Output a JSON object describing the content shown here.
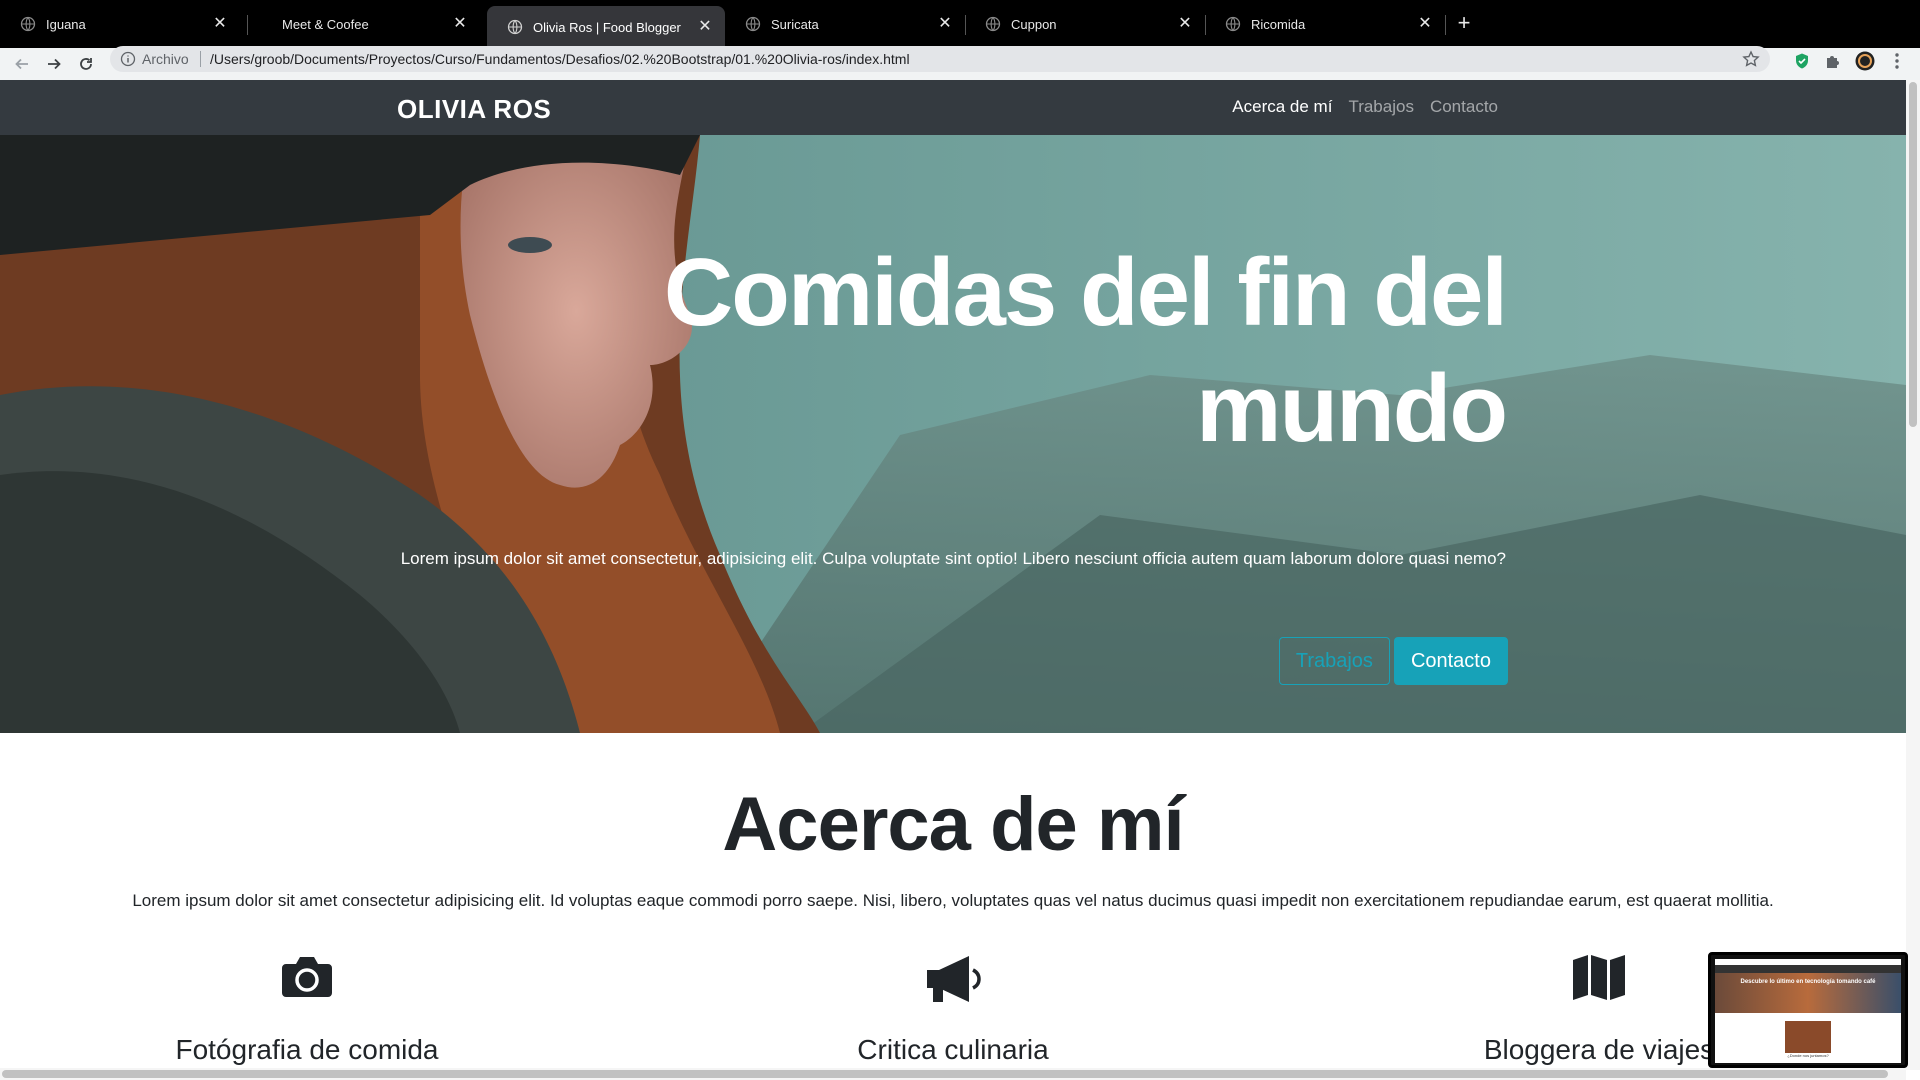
{
  "browser": {
    "tabs": [
      {
        "title": "Iguana",
        "active": false
      },
      {
        "title": "Meet & Coofee",
        "active": false
      },
      {
        "title": "Olivia Ros | Food Blogger",
        "active": true
      },
      {
        "title": "Suricata",
        "active": false
      },
      {
        "title": "Cuppon",
        "active": false
      },
      {
        "title": "Ricomida",
        "active": false
      }
    ],
    "omnibox": {
      "scheme_label": "Archivo",
      "url": "/Users/groob/Documents/Proyectos/Curso/Fundamentos/Desafios/02.%20Bootstrap/01.%20Olivia-ros/index.html"
    }
  },
  "navbar": {
    "brand": "OLIVIA ROS",
    "links": [
      "Acerca de mí",
      "Trabajos",
      "Contacto"
    ]
  },
  "hero": {
    "title_line1": "Comidas del fin del",
    "title_line2": "mundo",
    "text": "Lorem ipsum dolor sit amet consectetur, adipisicing elit. Culpa voluptate sint optio! Libero nesciunt officia autem quam laborum dolore quasi nemo?",
    "btn_outline": "Trabajos",
    "btn_primary": "Contacto"
  },
  "about": {
    "title": "Acerca de mí",
    "text": "Lorem ipsum dolor sit amet consectetur adipisicing elit. Id voluptas eaque commodi porro saepe. Nisi, libero, voluptates quas vel natus ducimus quasi impedit non exercitationem repudiandae earum, est quaerat mollitia.",
    "features": [
      {
        "icon": "camera-icon",
        "title": "Fotógrafia de comida"
      },
      {
        "icon": "megaphone-icon",
        "title": "Critica culinaria"
      },
      {
        "icon": "map-icon",
        "title": "Bloggera de viajes"
      }
    ]
  },
  "pip": {
    "headline": "Descubre lo último en tecnología tomando café",
    "caption": "¿Donde nos juntamos?"
  },
  "colors": {
    "navbar": "#343a40",
    "accent": "#17a2b8"
  }
}
